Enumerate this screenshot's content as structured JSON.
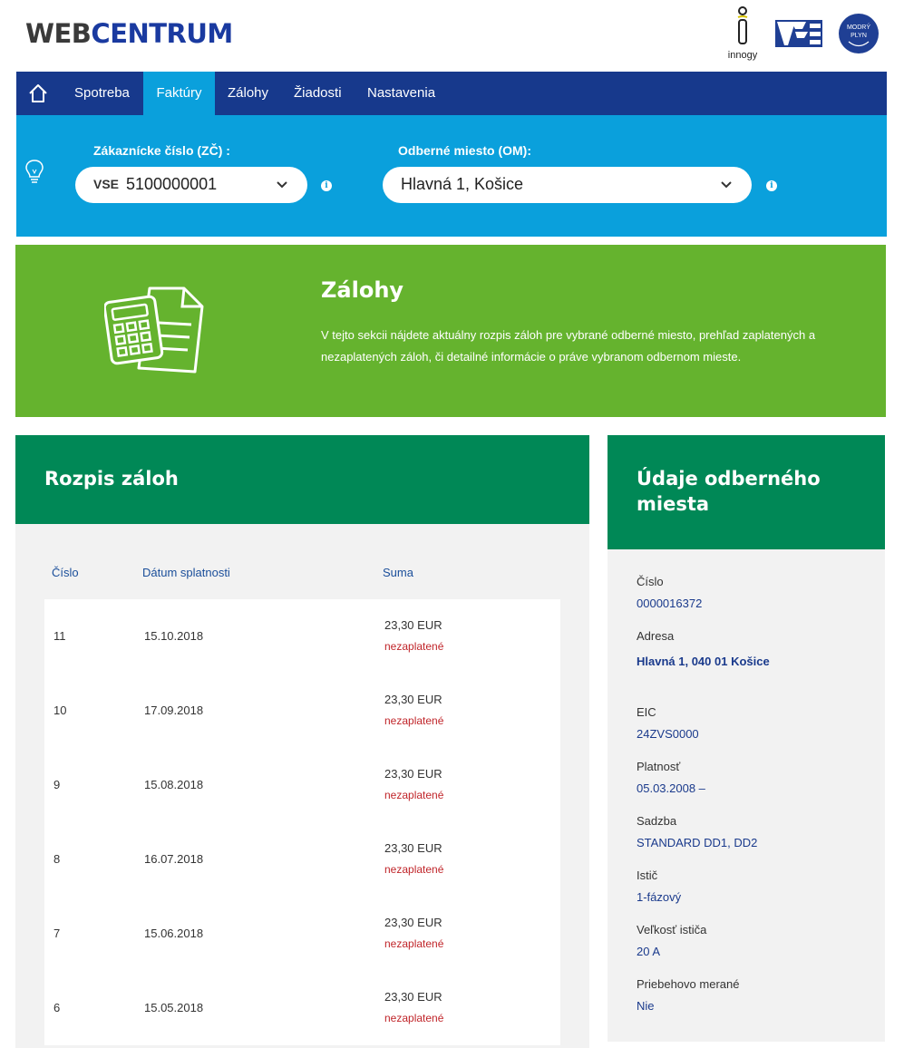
{
  "header": {
    "logo_part1": "WEB",
    "logo_part2": "CENTRUM",
    "brands": {
      "innogy": "innogy",
      "vse": "VSE",
      "modry_plyn_line1": "MODRÝ",
      "modry_plyn_line2": "PLYN"
    }
  },
  "nav": {
    "items": [
      {
        "label": "Spotreba"
      },
      {
        "label": "Faktúry",
        "active": true
      },
      {
        "label": "Zálohy"
      },
      {
        "label": "Žiadosti"
      },
      {
        "label": "Nastavenia"
      }
    ]
  },
  "selectors": {
    "customer": {
      "label": "Zákaznícke číslo (ZČ) :",
      "prefix": "VSE",
      "value": "5100000001"
    },
    "place": {
      "label": "Odberné miesto (OM):",
      "value": "Hlavná 1, Košice"
    }
  },
  "banner": {
    "title": "Zálohy",
    "text": "V tejto sekcii nájdete aktuálny rozpis záloh pre vybrané odberné miesto, prehľad zaplatených a nezaplatených záloh, či detailné informácie o práve vybranom odbernom mieste."
  },
  "rozpis": {
    "title": "Rozpis záloh",
    "columns": {
      "num": "Číslo",
      "date": "Dátum splatnosti",
      "sum": "Suma"
    },
    "rows": [
      {
        "num": "11",
        "date": "15.10.2018",
        "sum": "23,30 EUR",
        "status": "nezaplatené"
      },
      {
        "num": "10",
        "date": "17.09.2018",
        "sum": "23,30 EUR",
        "status": "nezaplatené"
      },
      {
        "num": "9",
        "date": "15.08.2018",
        "sum": "23,30 EUR",
        "status": "nezaplatené"
      },
      {
        "num": "8",
        "date": "16.07.2018",
        "sum": "23,30 EUR",
        "status": "nezaplatené"
      },
      {
        "num": "7",
        "date": "15.06.2018",
        "sum": "23,30 EUR",
        "status": "nezaplatené"
      },
      {
        "num": "6",
        "date": "15.05.2018",
        "sum": "23,30 EUR",
        "status": "nezaplatené"
      }
    ]
  },
  "udaje": {
    "title_line1": "Údaje odberného",
    "title_line2": "miesta",
    "fields": [
      {
        "label": "Číslo",
        "value": "0000016372"
      },
      {
        "label": "Adresa",
        "value": "Hlavná 1, 040 01 Košice"
      },
      {
        "label": "EIC",
        "value": "24ZVS0000"
      },
      {
        "label": "Platnosť",
        "value": "05.03.2008 –"
      },
      {
        "label": "Sadzba",
        "value": "STANDARD DD1, DD2"
      },
      {
        "label": "Istič",
        "value": "1-fázový"
      },
      {
        "label": "Veľkosť ističa",
        "value": "20 A"
      },
      {
        "label": "Priebehovo merané",
        "value": "Nie"
      }
    ]
  },
  "colors": {
    "nav_bg": "#17398c",
    "accent_blue": "#0aa0dc",
    "banner_green": "#65b32e",
    "panel_green": "#008856",
    "unpaid_red": "#c0252a"
  }
}
